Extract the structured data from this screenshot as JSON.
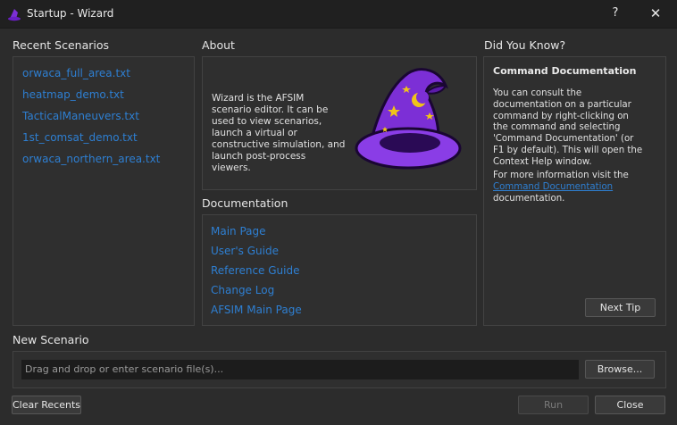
{
  "window": {
    "title": "Startup - Wizard",
    "help_label": "?",
    "close_label": "✕"
  },
  "recent": {
    "heading": "Recent Scenarios",
    "items": [
      "orwaca_full_area.txt",
      "heatmap_demo.txt",
      "TacticalManeuvers.txt",
      "1st_comsat_demo.txt",
      "orwaca_northern_area.txt"
    ]
  },
  "about": {
    "heading": "About",
    "text": "Wizard is the AFSIM scenario editor. It can be used to view scenarios, launch a virtual or constructive simulation, and launch post-process viewers."
  },
  "documentation": {
    "heading": "Documentation",
    "links": [
      "Main Page",
      "User's Guide",
      "Reference Guide",
      "Change Log",
      "AFSIM Main Page"
    ]
  },
  "tips": {
    "heading": "Did You Know?",
    "title": "Command Documentation",
    "body": "You can consult the documentation on a particular command by right-clicking on the command and selecting 'Command Documentation' (or F1 by default). This will open the Context Help window.",
    "more_prefix": "For more information visit the",
    "more_link": "Command Documentation",
    "more_suffix": "documentation.",
    "next_label": "Next Tip"
  },
  "new_scenario": {
    "heading": "New Scenario",
    "placeholder": "Drag and drop or enter scenario file(s)...",
    "browse_label": "Browse..."
  },
  "footer": {
    "clear_label": "Clear Recents",
    "run_label": "Run",
    "close_label": "Close"
  },
  "colors": {
    "link": "#2e7fd2",
    "hat_purple": "#7c2fd6",
    "hat_dark": "#2a0a55",
    "stars": "#f0c419"
  }
}
